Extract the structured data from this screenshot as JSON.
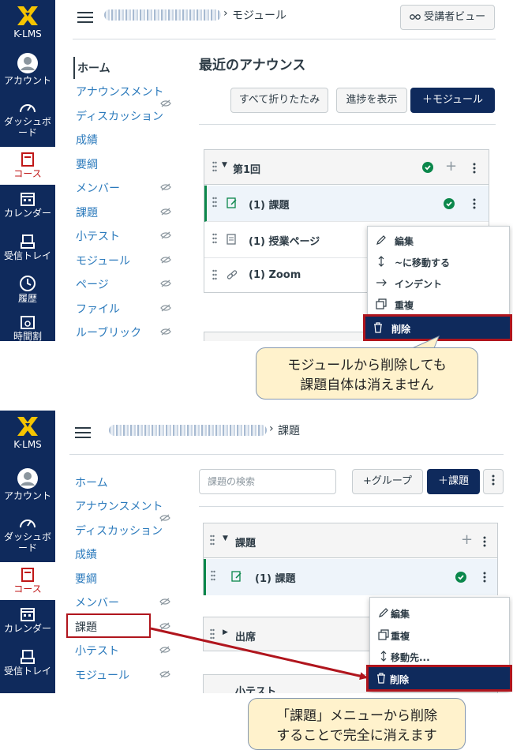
{
  "brand": {
    "name": "K-LMS"
  },
  "global_nav": [
    {
      "key": "account",
      "label": "アカウント",
      "icon": "user-circle-icon"
    },
    {
      "key": "dashboard",
      "label": "ダッシュボード",
      "icon": "dashboard-gauge-icon"
    },
    {
      "key": "courses",
      "label": "コース",
      "icon": "book-icon",
      "active": true
    },
    {
      "key": "calendar",
      "label": "カレンダー",
      "icon": "calendar-icon"
    },
    {
      "key": "inbox",
      "label": "受信トレイ",
      "icon": "inbox-tray-icon"
    },
    {
      "key": "history",
      "label": "履歴",
      "icon": "clock-icon"
    },
    {
      "key": "timetable",
      "label": "時間割",
      "icon": "timetable-icon"
    }
  ],
  "course_nav": [
    {
      "key": "home",
      "label": "ホーム",
      "hidden": false
    },
    {
      "key": "announcements",
      "label": "アナウンスメント",
      "hidden": false
    },
    {
      "key": "discussions",
      "label": "ディスカッション",
      "hidden": true
    },
    {
      "key": "grades",
      "label": "成績",
      "hidden": false
    },
    {
      "key": "syllabus",
      "label": "要綱",
      "hidden": false
    },
    {
      "key": "people",
      "label": "メンバー",
      "hidden": true
    },
    {
      "key": "assignments",
      "label": "課題",
      "hidden": true
    },
    {
      "key": "quizzes",
      "label": "小テスト",
      "hidden": true
    },
    {
      "key": "modules",
      "label": "モジュール",
      "hidden": true
    },
    {
      "key": "pages",
      "label": "ページ",
      "hidden": true
    },
    {
      "key": "files",
      "label": "ファイル",
      "hidden": true
    },
    {
      "key": "rubrics",
      "label": "ルーブリック",
      "hidden": true
    }
  ],
  "panel1": {
    "breadcrumb_current": "モジュール",
    "student_view_label": "受講者ビュー",
    "heading": "最近のアナウンス",
    "toolbar": {
      "collapse_all_label": "すべて折りたたみ",
      "progress_label": "進捗を表示",
      "add_module_label": "＋モジュール"
    },
    "module": {
      "title": "第1回",
      "items": [
        {
          "title": "(1) 課題",
          "icon": "assignment-icon",
          "published": true
        },
        {
          "title": "(1) 授業ページ",
          "icon": "page-icon",
          "published": false
        },
        {
          "title": "(1) Zoom",
          "icon": "link-icon",
          "published": false
        }
      ]
    },
    "menu": [
      {
        "label": "編集",
        "icon": "pencil-icon"
      },
      {
        "label": "~に移動する",
        "icon": "move-updown-icon"
      },
      {
        "label": "インデント",
        "icon": "arrow-right-icon"
      },
      {
        "label": "重複",
        "icon": "duplicate-icon"
      },
      {
        "label": "削除",
        "icon": "trash-icon",
        "danger": true
      }
    ],
    "callout": [
      "モジュールから削除しても",
      "課題自体は消えません"
    ]
  },
  "panel2": {
    "breadcrumb_current": "課題",
    "search_placeholder": "課題の検索",
    "toolbar": {
      "add_group_label": "+グループ",
      "add_assignment_label": "＋課題"
    },
    "groups": [
      {
        "title": "課題",
        "expanded": true
      },
      {
        "title": "出席",
        "expanded": false
      },
      {
        "title": "小テスト",
        "expanded": true
      }
    ],
    "item": {
      "title": "(1) 課題",
      "published": true
    },
    "menu": [
      {
        "label": "編集",
        "icon": "pencil-icon"
      },
      {
        "label": "重複",
        "icon": "duplicate-icon"
      },
      {
        "label": "移動先...",
        "icon": "move-updown-icon"
      },
      {
        "label": "削除",
        "icon": "trash-icon",
        "danger": true
      }
    ],
    "callout": [
      "「課題」メニューから削除",
      "することで完全に消えます"
    ]
  },
  "colors": {
    "nav_bg": "#0f2a5c",
    "brand_yellow": "#f5c400",
    "link_blue": "#2b7abc",
    "success_green": "#0b874b",
    "highlight_red": "#b0151d",
    "callout_bg": "#fff2cc"
  }
}
